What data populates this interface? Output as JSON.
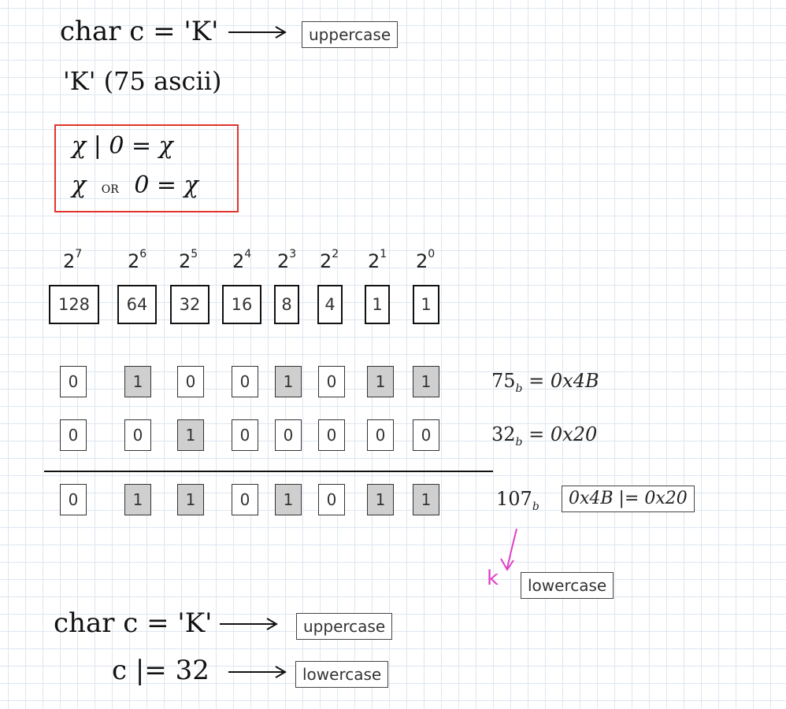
{
  "header": {
    "char_decl": "char c = 'K'",
    "uppercase_tag": "uppercase",
    "ascii_note": "'K' (75 ascii)"
  },
  "rule_box": {
    "line1": "χ | 0 = χ",
    "line2_left": "χ",
    "line2_op": "OR",
    "line2_right": "0 = χ"
  },
  "powers": [
    {
      "base": "2",
      "exp": "7",
      "value": "128"
    },
    {
      "base": "2",
      "exp": "6",
      "value": "64"
    },
    {
      "base": "2",
      "exp": "5",
      "value": "32"
    },
    {
      "base": "2",
      "exp": "4",
      "value": "16"
    },
    {
      "base": "2",
      "exp": "3",
      "value": "8"
    },
    {
      "base": "2",
      "exp": "2",
      "value": "4"
    },
    {
      "base": "2",
      "exp": "1",
      "value": "1"
    },
    {
      "base": "2",
      "exp": "0",
      "value": "1"
    }
  ],
  "bit_rows": [
    {
      "bits": [
        "0",
        "1",
        "0",
        "0",
        "1",
        "0",
        "1",
        "1"
      ],
      "filled": [
        false,
        true,
        false,
        false,
        true,
        false,
        true,
        true
      ],
      "label_num": "75",
      "label_sub": "b",
      "label_eq": "= 0x4B"
    },
    {
      "bits": [
        "0",
        "0",
        "1",
        "0",
        "0",
        "0",
        "0",
        "0"
      ],
      "filled": [
        false,
        false,
        true,
        false,
        false,
        false,
        false,
        false
      ],
      "label_num": "32",
      "label_sub": "b",
      "label_eq": "= 0x20"
    },
    {
      "bits": [
        "0",
        "1",
        "1",
        "0",
        "1",
        "0",
        "1",
        "1"
      ],
      "filled": [
        false,
        true,
        true,
        false,
        true,
        false,
        true,
        true
      ],
      "label_num": "107",
      "label_sub": "b",
      "label_eq": ""
    }
  ],
  "or_expression": "0x4B |= 0x20",
  "result_char": "k",
  "lowercase_tag": "lowercase",
  "footer": {
    "char_decl": "char c = 'K'",
    "uppercase_tag": "uppercase",
    "op_line": "c |= 32",
    "lowercase_tag": "lowercase"
  },
  "colors": {
    "rule_border": "#e0342c",
    "annotation": "#e040c8",
    "bit_fill": "#cfcfcf"
  }
}
